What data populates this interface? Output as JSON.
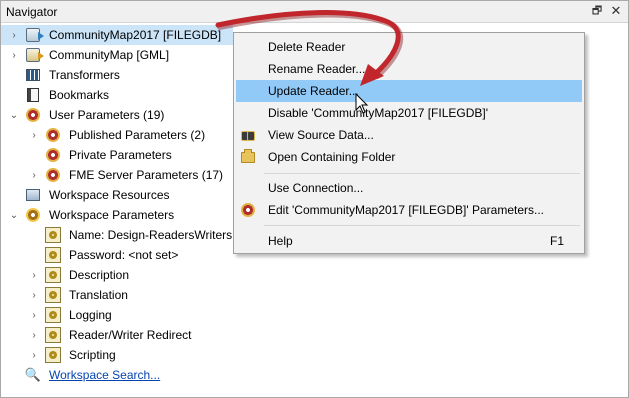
{
  "panel": {
    "title": "Navigator",
    "pin_glyph": "🗗",
    "close_glyph": "✕"
  },
  "tree": [
    {
      "label": "CommunityMap2017 [FILEGDB]",
      "icon": "reader-icon",
      "expandable": true,
      "selected": true
    },
    {
      "label": "CommunityMap [GML]",
      "icon": "reader-icon",
      "expandable": true,
      "selected": false
    },
    {
      "label": "Transformers",
      "icon": "transformers-icon",
      "expandable": false,
      "selected": false
    },
    {
      "label": "Bookmarks",
      "icon": "bookmarks-icon",
      "expandable": false,
      "selected": false
    },
    {
      "label": "User Parameters (19)",
      "icon": "parameters-gear-icon",
      "expandable": true,
      "expanded": true
    },
    {
      "label": "Published Parameters (2)",
      "icon": "parameters-gear-icon",
      "expandable": true
    },
    {
      "label": "Private Parameters",
      "icon": "parameters-gear-icon",
      "expandable": false
    },
    {
      "label": "FME Server Parameters (17)",
      "icon": "parameters-gear-icon",
      "expandable": true
    },
    {
      "label": "Workspace Resources",
      "icon": "resources-icon",
      "expandable": false
    },
    {
      "label": "Workspace Parameters",
      "icon": "workspace-gear-icon",
      "expandable": true,
      "expanded": true
    },
    {
      "label": "Name: Design-ReadersWriters",
      "icon": "parameter-icon",
      "expandable": false
    },
    {
      "label": "Password: <not set>",
      "icon": "parameter-icon",
      "expandable": false
    },
    {
      "label": "Description",
      "icon": "parameter-icon",
      "expandable": true
    },
    {
      "label": "Translation",
      "icon": "parameter-icon",
      "expandable": true
    },
    {
      "label": "Logging",
      "icon": "parameter-icon",
      "expandable": true
    },
    {
      "label": "Reader/Writer Redirect",
      "icon": "parameter-icon",
      "expandable": true
    },
    {
      "label": "Scripting",
      "icon": "parameter-icon",
      "expandable": true
    },
    {
      "label": "Workspace Search...",
      "icon": "search-icon",
      "expandable": false,
      "link": true
    }
  ],
  "context_menu": {
    "items": [
      {
        "label": "Delete Reader",
        "icon": ""
      },
      {
        "label": "Rename Reader...",
        "icon": ""
      },
      {
        "label": "Update Reader...",
        "icon": "",
        "highlighted": true
      },
      {
        "label": "Disable 'CommunityMap2017 [FILEGDB]'",
        "icon": ""
      },
      {
        "label": "View Source Data...",
        "icon": "binoculars-icon"
      },
      {
        "label": "Open Containing Folder",
        "icon": "folder-icon"
      },
      {
        "label": "Use Connection...",
        "icon": ""
      },
      {
        "label": "Edit 'CommunityMap2017 [FILEGDB]' Parameters...",
        "icon": "parameters-gear-icon"
      },
      {
        "label": "Help",
        "icon": "",
        "shortcut": "F1"
      }
    ]
  },
  "colors": {
    "selected_row": "#cce4f7",
    "menu_highlight": "#91c9f7",
    "annotation_arrow": "#c0262b",
    "link": "#0645ad"
  }
}
